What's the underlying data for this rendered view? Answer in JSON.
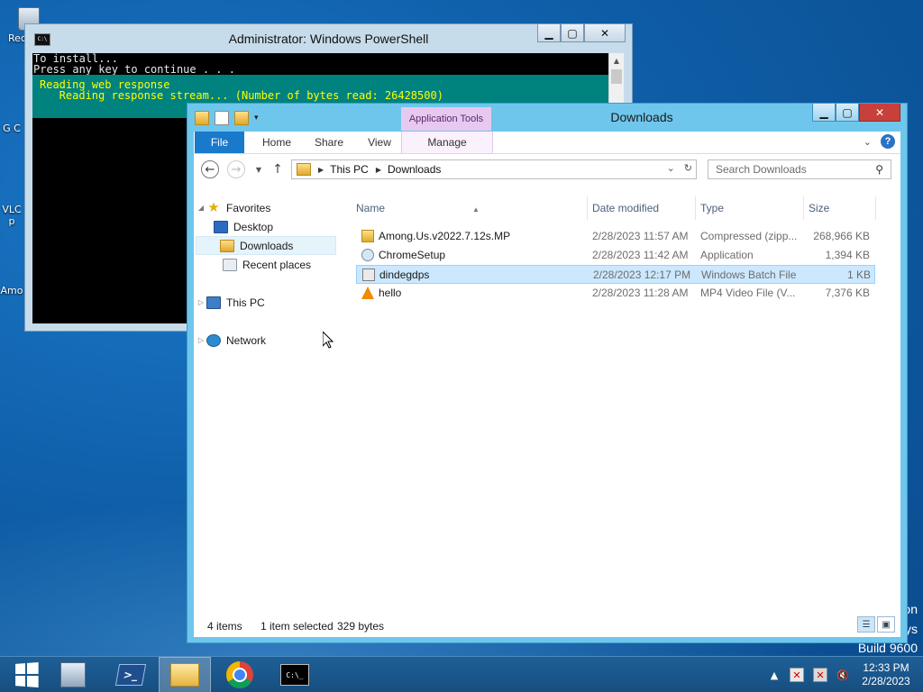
{
  "desktop": {
    "icons": [
      {
        "label": "Rec"
      },
      {
        "label": "G C"
      },
      {
        "label": "VLC p"
      },
      {
        "label": "Amo"
      }
    ],
    "watermark_lines": [
      "on",
      "ys",
      "Build 9600"
    ]
  },
  "powershell": {
    "title": "Administrator: Windows PowerShell",
    "lines": [
      "To install...",
      "Press any key to continue . . ."
    ],
    "progress_lines": [
      "Reading web response",
      "   Reading response stream... (Number of bytes read: 26428500)"
    ],
    "buttons": {
      "minimize": "▁",
      "maximize": "▢",
      "close": "✕"
    }
  },
  "explorer": {
    "title": "Downloads",
    "contextual_tab_group": "Application Tools",
    "ribbon_tabs": [
      "File",
      "Home",
      "Share",
      "View",
      "Manage"
    ],
    "address": {
      "path": [
        "This PC",
        "Downloads"
      ]
    },
    "search": {
      "placeholder": "Search Downloads"
    },
    "navigation": {
      "favorites_label": "Favorites",
      "favorites_items": [
        "Desktop",
        "Downloads",
        "Recent places"
      ],
      "selected": "Downloads",
      "this_pc": "This PC",
      "network": "Network"
    },
    "columns": {
      "name": "Name",
      "date": "Date modified",
      "type": "Type",
      "size": "Size"
    },
    "files": [
      {
        "name": "Among.Us.v2022.7.12s.MP",
        "date": "2/28/2023 11:57 AM",
        "type": "Compressed (zipp...",
        "size": "268,966 KB",
        "icon": "zip-folder-icon"
      },
      {
        "name": "ChromeSetup",
        "date": "2/28/2023 11:42 AM",
        "type": "Application",
        "size": "1,394 KB",
        "icon": "application-icon"
      },
      {
        "name": "dindegdps",
        "date": "2/28/2023 12:17 PM",
        "type": "Windows Batch File",
        "size": "1 KB",
        "icon": "batch-file-icon",
        "selected": true
      },
      {
        "name": "hello",
        "date": "2/28/2023 11:28 AM",
        "type": "MP4 Video File (V...",
        "size": "7,376 KB",
        "icon": "vlc-icon"
      }
    ],
    "status": {
      "count": "4 items",
      "selection": "1 item selected",
      "size": "329 bytes"
    }
  },
  "taskbar": {
    "apps": [
      "start",
      "server-manager",
      "powershell",
      "file-explorer",
      "chrome",
      "cmd"
    ],
    "active": "file-explorer",
    "clock": {
      "time": "12:33 PM",
      "date": "2/28/2023"
    },
    "tray_arrow": "▲",
    "cmd_label": "C:\\_"
  },
  "colors": {
    "desktop_bg": "#0f5ea8",
    "explorer_frame": "#6fc6ec",
    "file_tab": "#1979ca",
    "selection": "#cce8ff",
    "console_progress": "#00827f",
    "console_progress_text": "#ffff00"
  }
}
